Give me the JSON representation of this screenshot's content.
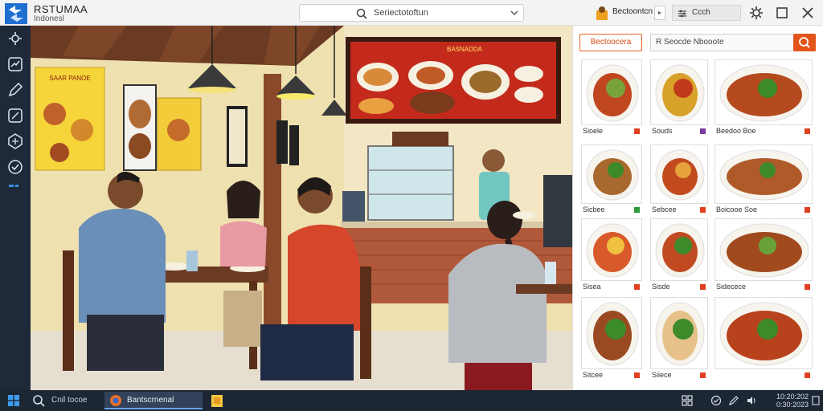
{
  "app": {
    "title": "RSTUMAA",
    "subtitle": "Indonesl"
  },
  "search": {
    "text": "Seriectotoftun"
  },
  "user": {
    "name": "Bectoontcn"
  },
  "filter": {
    "text": "Ccch"
  },
  "panel": {
    "button_label": "Bectoocera",
    "search_text": "R  Seocde Nbooote",
    "tiles": [
      {
        "label": "Sioele",
        "badge_color": "#e04020"
      },
      {
        "label": "Souds",
        "badge_color": "#7a3aa0"
      },
      {
        "label": "Beedoo Boe",
        "badge_color": "#e04020"
      },
      {
        "label": "Sicbee",
        "badge_color": "#2a9a3a"
      },
      {
        "label": "Sebcee",
        "badge_color": "#e04020"
      },
      {
        "label": "Boicooe Soe",
        "badge_color": "#e04020"
      },
      {
        "label": "Sisea",
        "badge_color": "#e04020"
      },
      {
        "label": "Sisde",
        "badge_color": "#e04020"
      },
      {
        "label": "Sidecece",
        "badge_color": "#e04020"
      },
      {
        "label": "Sitcee",
        "badge_color": "#e04020"
      },
      {
        "label": "Siiece",
        "badge_color": "#e04020"
      },
      {
        "label": "",
        "badge_color": "#e04020"
      }
    ]
  },
  "taskbar": {
    "search_text": "Cnil tocoe",
    "app_label": "Bantscrnenal",
    "clock_time": "10:20:202",
    "clock_date": "0:30:2023"
  },
  "scene": {
    "menu_board_title": "BASNADDA",
    "poster_title": "SAAR PANOE"
  }
}
